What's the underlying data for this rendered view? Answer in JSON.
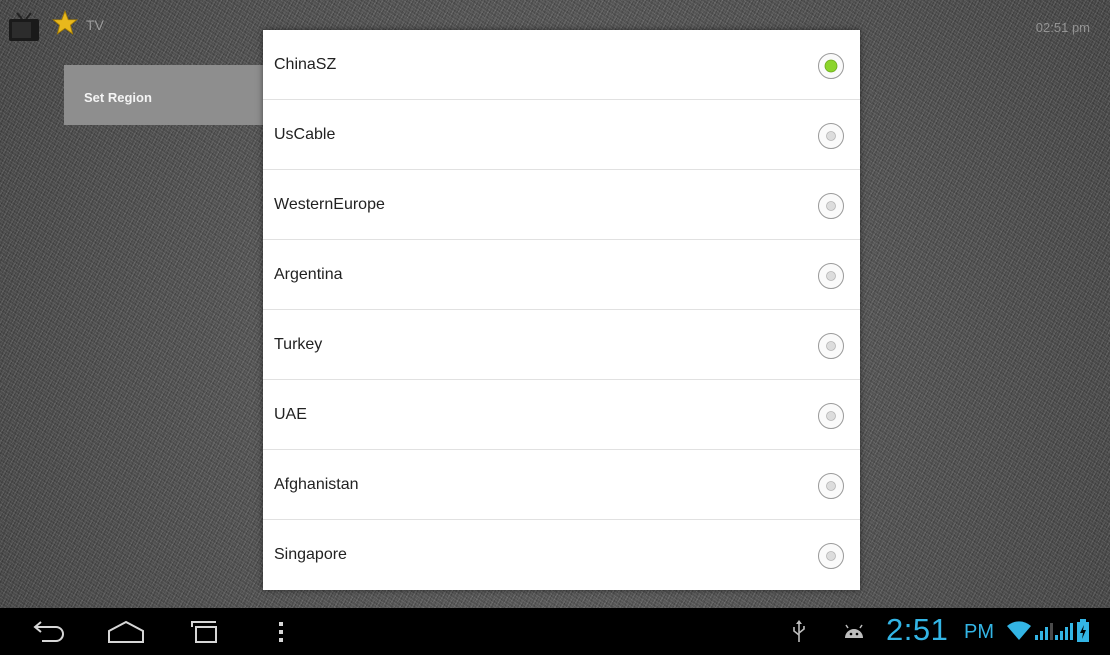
{
  "app": {
    "title": "TV",
    "clock": "02:51 pm"
  },
  "menu": {
    "items": [
      {
        "label": "Set Region"
      }
    ]
  },
  "dialog": {
    "options": [
      {
        "label": "ChinaSZ",
        "selected": true
      },
      {
        "label": "UsCable",
        "selected": false
      },
      {
        "label": "WesternEurope",
        "selected": false
      },
      {
        "label": "Argentina",
        "selected": false
      },
      {
        "label": "Turkey",
        "selected": false
      },
      {
        "label": "UAE",
        "selected": false
      },
      {
        "label": "Afghanistan",
        "selected": false
      },
      {
        "label": "Singapore",
        "selected": false
      }
    ]
  },
  "system_bar": {
    "time": "2:51",
    "ampm": "PM",
    "icons": [
      "back-icon",
      "home-icon",
      "recents-icon",
      "overflow-menu-icon",
      "usb-icon",
      "android-debug-icon",
      "wifi-icon",
      "signal-icon",
      "battery-icon"
    ]
  },
  "colors": {
    "accent": "#33b5e5",
    "radio_selected": "#8bd42a",
    "menu_panel": "#8e8e8e"
  }
}
